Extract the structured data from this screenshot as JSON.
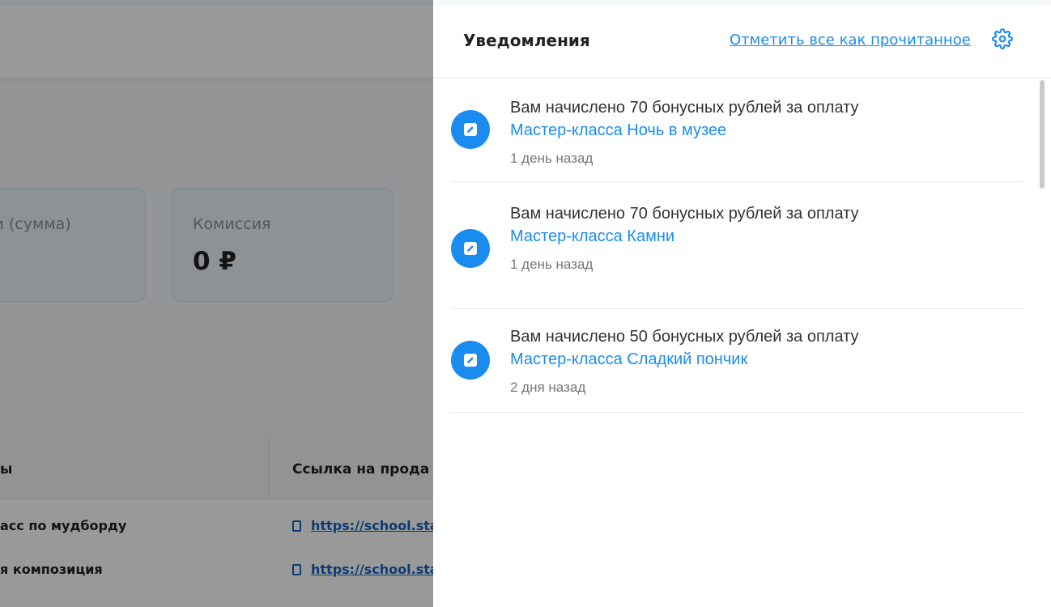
{
  "background": {
    "cards": [
      {
        "label": "ки (сумма)"
      },
      {
        "label": "Комиссия",
        "value": "0 ₽"
      }
    ],
    "table": {
      "headers": [
        "ы",
        "Ссылка на прода"
      ],
      "rows": [
        {
          "name": "асс по мудборду",
          "link": "https://school.star"
        },
        {
          "name": "я композиция",
          "link": "https://school.star"
        }
      ]
    }
  },
  "panel": {
    "title": "Уведомления",
    "mark_all_label": "Отметить все как прочитанное",
    "settings_icon": "gear-icon",
    "notifications": [
      {
        "text": "Вам начислено 70 бонусных рублей за оплату",
        "link": "Мастер-класса Ночь в музее",
        "time": "1 день назад",
        "icon": "pencil-icon"
      },
      {
        "text": "Вам начислено 70 бонусных рублей за оплату",
        "link": "Мастер-класса Камни",
        "time": "1 день назад",
        "icon": "pencil-icon"
      },
      {
        "text": "Вам начислено 50 бонусных рублей за оплату",
        "link": "Мастер-класса Сладкий пончик",
        "time": "2 дня назад",
        "icon": "pencil-icon"
      }
    ]
  },
  "colors": {
    "accent": "#1a8cf0",
    "overlay": "rgba(0,0,0,0.40)"
  }
}
